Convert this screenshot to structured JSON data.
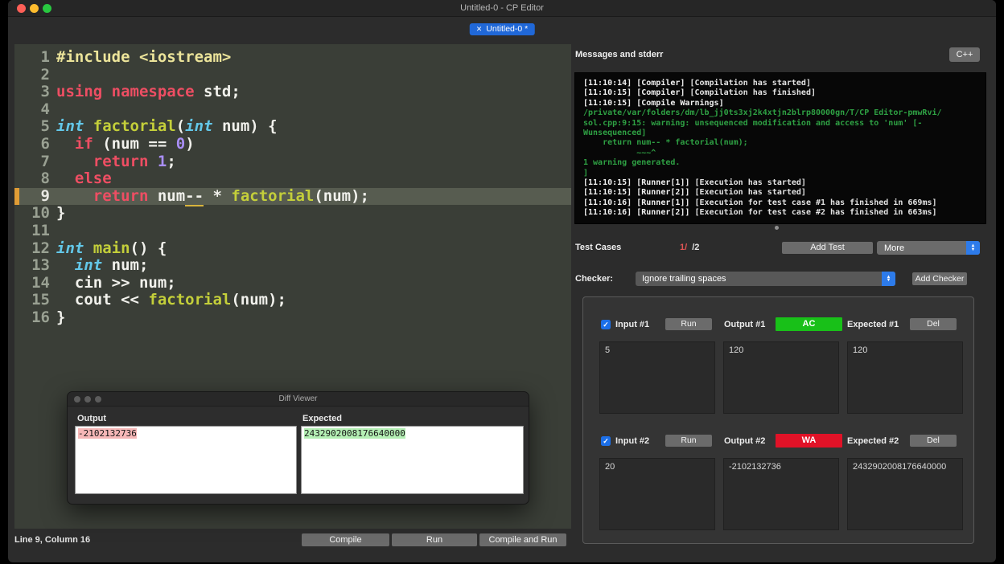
{
  "window": {
    "title": "Untitled-0 - CP Editor",
    "traffic_lights": {
      "close": "#ff5f57",
      "minimize": "#febc2e",
      "zoom": "#28c840"
    }
  },
  "tab": {
    "close_glyph": "✕",
    "label": "Untitled-0 *",
    "accent": "#2068d8"
  },
  "editor": {
    "current_line": 9,
    "lines": [
      {
        "num": 1,
        "segments": [
          {
            "cls": "pp",
            "text": "#include <iostream>"
          }
        ]
      },
      {
        "num": 2,
        "segments": []
      },
      {
        "num": 3,
        "segments": [
          {
            "cls": "kw",
            "text": "using namespace"
          },
          {
            "cls": "pl",
            "text": " std;"
          }
        ]
      },
      {
        "num": 4,
        "segments": []
      },
      {
        "num": 5,
        "segments": [
          {
            "cls": "ty",
            "text": "int"
          },
          {
            "cls": "pl",
            "text": " "
          },
          {
            "cls": "fn",
            "text": "factorial"
          },
          {
            "cls": "pl",
            "text": "("
          },
          {
            "cls": "ty",
            "text": "int"
          },
          {
            "cls": "pl",
            "text": " num) {"
          }
        ]
      },
      {
        "num": 6,
        "segments": [
          {
            "cls": "pl",
            "text": "  "
          },
          {
            "cls": "kw",
            "text": "if"
          },
          {
            "cls": "pl",
            "text": " (num == "
          },
          {
            "cls": "num",
            "text": "0"
          },
          {
            "cls": "pl",
            "text": ")"
          }
        ]
      },
      {
        "num": 7,
        "segments": [
          {
            "cls": "pl",
            "text": "    "
          },
          {
            "cls": "kw",
            "text": "return"
          },
          {
            "cls": "pl",
            "text": " "
          },
          {
            "cls": "num",
            "text": "1"
          },
          {
            "cls": "pl",
            "text": ";"
          }
        ]
      },
      {
        "num": 8,
        "segments": [
          {
            "cls": "pl",
            "text": "  "
          },
          {
            "cls": "kw",
            "text": "else"
          }
        ]
      },
      {
        "num": 9,
        "segments": [
          {
            "cls": "pl",
            "text": "    "
          },
          {
            "cls": "kw",
            "text": "return"
          },
          {
            "cls": "pl",
            "text": " num"
          },
          {
            "cls": "warn",
            "text": "--"
          },
          {
            "cls": "pl",
            "text": " * "
          },
          {
            "cls": "fn",
            "text": "factorial"
          },
          {
            "cls": "pl",
            "text": "(num);"
          }
        ]
      },
      {
        "num": 10,
        "segments": [
          {
            "cls": "pl",
            "text": "}"
          }
        ]
      },
      {
        "num": 11,
        "segments": []
      },
      {
        "num": 12,
        "segments": [
          {
            "cls": "ty",
            "text": "int"
          },
          {
            "cls": "pl",
            "text": " "
          },
          {
            "cls": "fn",
            "text": "main"
          },
          {
            "cls": "pl",
            "text": "() {"
          }
        ]
      },
      {
        "num": 13,
        "segments": [
          {
            "cls": "pl",
            "text": "  "
          },
          {
            "cls": "ty",
            "text": "int"
          },
          {
            "cls": "pl",
            "text": " num;"
          }
        ]
      },
      {
        "num": 14,
        "segments": [
          {
            "cls": "pl",
            "text": "  cin >> num;"
          }
        ]
      },
      {
        "num": 15,
        "segments": [
          {
            "cls": "pl",
            "text": "  cout << "
          },
          {
            "cls": "fn",
            "text": "factorial"
          },
          {
            "cls": "pl",
            "text": "(num);"
          }
        ]
      },
      {
        "num": 16,
        "segments": [
          {
            "cls": "pl",
            "text": "}"
          }
        ]
      }
    ]
  },
  "status_bar": {
    "position": "Line 9, Column 16",
    "compile": "Compile",
    "run": "Run",
    "compile_and_run": "Compile and Run"
  },
  "messages": {
    "title": "Messages and stderr",
    "language_button": "C++",
    "console_lines": [
      {
        "segments": [
          {
            "cls": "b",
            "text": "[11:10:14] [Compiler] "
          },
          {
            "cls": "n",
            "text": "[Compilation has started]"
          }
        ]
      },
      {
        "segments": [
          {
            "cls": "b",
            "text": "[11:10:15] [Compiler] "
          },
          {
            "cls": "n",
            "text": "[Compilation has finished]"
          }
        ]
      },
      {
        "segments": [
          {
            "cls": "b",
            "text": "[11:10:15] [Compile Warnings] "
          }
        ]
      },
      {
        "segments": [
          {
            "cls": "g",
            "text": "/private/var/folders/dm/lb_jj0ts3xj2k4xtjn2blrp80000gn/T/CP Editor-pmwRvi/"
          }
        ]
      },
      {
        "segments": [
          {
            "cls": "g",
            "text": "sol.cpp:9:15: warning: unsequenced modification and access to 'num' [-"
          }
        ]
      },
      {
        "segments": [
          {
            "cls": "g",
            "text": "Wunsequenced]"
          }
        ]
      },
      {
        "segments": [
          {
            "cls": "g",
            "text": "    return num-- * factorial(num);"
          }
        ]
      },
      {
        "segments": [
          {
            "cls": "g",
            "text": "           ~~~^"
          }
        ]
      },
      {
        "segments": [
          {
            "cls": "g",
            "text": "1 warning generated."
          }
        ]
      },
      {
        "segments": [
          {
            "cls": "g",
            "text": "]"
          }
        ]
      },
      {
        "segments": [
          {
            "cls": "b",
            "text": "[11:10:15] [Runner[1]] "
          },
          {
            "cls": "n",
            "text": "[Execution has started]"
          }
        ]
      },
      {
        "segments": [
          {
            "cls": "b",
            "text": "[11:10:15] [Runner[2]] "
          },
          {
            "cls": "n",
            "text": "[Execution has started]"
          }
        ]
      },
      {
        "segments": [
          {
            "cls": "b",
            "text": "[11:10:16] [Runner[1]] "
          },
          {
            "cls": "n",
            "text": "[Execution for test case #1 has finished in 669ms]"
          }
        ]
      },
      {
        "segments": [
          {
            "cls": "b",
            "text": "[11:10:16] [Runner[2]] "
          },
          {
            "cls": "n",
            "text": "[Execution for test case #2 has finished in 663ms]"
          }
        ]
      }
    ]
  },
  "test_header": {
    "label": "Test Cases",
    "summary": [
      {
        "text": "1/",
        "color": "#e05555"
      },
      {
        "text": "/2",
        "color": "#e8e8e8"
      }
    ],
    "add_test": "Add Test",
    "more": "More"
  },
  "checker": {
    "label": "Checker:",
    "selected": "Ignore trailing spaces",
    "add_checker": "Add Checker"
  },
  "test_cases": {
    "cases": [
      {
        "input_label": "Input #1",
        "run": "Run",
        "output_label": "Output #1",
        "verdict": "AC",
        "verdict_color": "#18c018",
        "expected_label": "Expected #1",
        "delete": "Del",
        "checked": true,
        "input": "5",
        "output": "120",
        "expected": "120"
      },
      {
        "input_label": "Input #2",
        "run": "Run",
        "output_label": "Output #2",
        "verdict": "WA",
        "verdict_color": "#e11227",
        "expected_label": "Expected #2",
        "delete": "Del",
        "checked": true,
        "input": "20",
        "output": "-2102132736",
        "expected": "2432902008176640000"
      }
    ]
  },
  "diff_viewer": {
    "title": "Diff Viewer",
    "output_label": "Output",
    "expected_label": "Expected",
    "output_text": "-2102132736",
    "expected_text": "2432902008176640000"
  }
}
